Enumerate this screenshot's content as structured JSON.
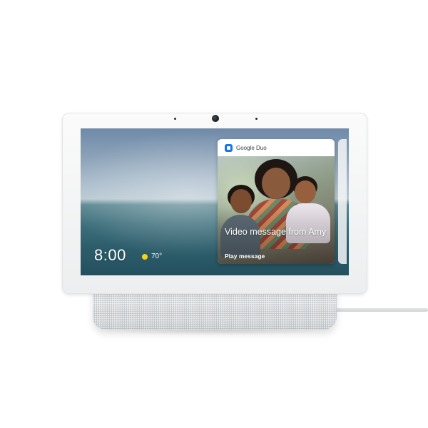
{
  "device": {
    "screen": {
      "clock": "8:00",
      "weather": {
        "icon": "sun-icon",
        "temperature": "70°"
      },
      "notification": {
        "app_icon": "google-duo-icon",
        "app_name": "Google Duo",
        "title": "Video message from Amy",
        "action_label": "Play message"
      }
    },
    "colors": {
      "duo_blue": "#1a73e8",
      "sun_yellow": "#f7d21a"
    }
  }
}
